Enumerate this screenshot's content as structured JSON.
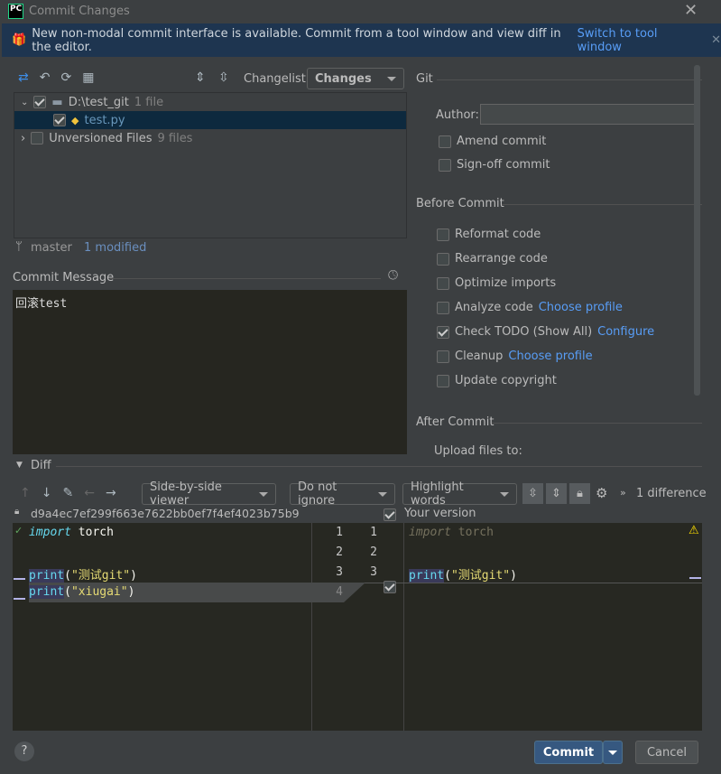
{
  "window": {
    "title": "Commit Changes",
    "logo": "PC",
    "close_icon": "close-icon"
  },
  "banner": {
    "text": "New non-modal commit interface is available. Commit from a tool window and view diff in the editor.",
    "link": "Switch to tool window"
  },
  "toolbar": {
    "changelist_label": "Changelist:",
    "changelist_value": "Changes"
  },
  "tree": [
    {
      "label": "D:\\test_git",
      "count": "1 file",
      "checked": true,
      "expanded": true
    },
    {
      "label": "test.py",
      "checked": true,
      "selected": true
    },
    {
      "label": "Unversioned Files",
      "count": "9 files",
      "checked": false,
      "expanded": false
    }
  ],
  "status": {
    "branch": "master",
    "modified": "1 modified"
  },
  "commit_message": {
    "label": "Commit Message",
    "value": "回滚test"
  },
  "git": {
    "section": "Git",
    "author_label": "Author:",
    "author_value": "",
    "amend": "Amend commit",
    "signoff": "Sign-off commit"
  },
  "before_commit": {
    "section": "Before Commit",
    "options": [
      {
        "label": "Reformat code",
        "checked": false
      },
      {
        "label": "Rearrange code",
        "checked": false
      },
      {
        "label": "Optimize imports",
        "checked": false
      },
      {
        "label": "Analyze code",
        "link": "Choose profile",
        "checked": false
      },
      {
        "label": "Check TODO (Show All)",
        "link": "Configure",
        "checked": true
      },
      {
        "label": "Cleanup",
        "link": "Choose profile",
        "checked": false
      },
      {
        "label": "Update copyright",
        "checked": false
      }
    ]
  },
  "after_commit": {
    "section": "After Commit",
    "upload": "Upload files to:"
  },
  "diff": {
    "label": "Diff",
    "viewer": "Side-by-side viewer",
    "ignore": "Do not ignore",
    "highlight": "Highlight words",
    "differences": "1 difference",
    "left_rev": "d9a4ec7ef299f663e7622bb0ef7f4ef4023b75b9",
    "right_rev": "Your version",
    "left_lines": [
      {
        "kw": "import",
        "rest": " torch"
      },
      {
        "kw": "",
        "rest": ""
      },
      {
        "fn": "print",
        "open": "(",
        "str": "\"测试git\"",
        "close": ")"
      },
      {
        "fn": "print",
        "open": "(",
        "str": "\"xiugai\"",
        "close": ")"
      }
    ],
    "left_nums": [
      "1",
      "2",
      "3",
      "4"
    ],
    "right_nums": [
      "1",
      "2",
      "3"
    ],
    "right_lines": [
      {
        "kw": "import",
        "rest": " torch"
      },
      {
        "kw": "",
        "rest": ""
      },
      {
        "fn": "print",
        "open": "(",
        "str": "\"测试git\"",
        "close": ")"
      }
    ]
  },
  "footer": {
    "help": "?",
    "commit": "Commit",
    "cancel": "Cancel"
  },
  "colors": {
    "accent": "#365880",
    "banner": "#1e3550",
    "link": "#589df6"
  }
}
